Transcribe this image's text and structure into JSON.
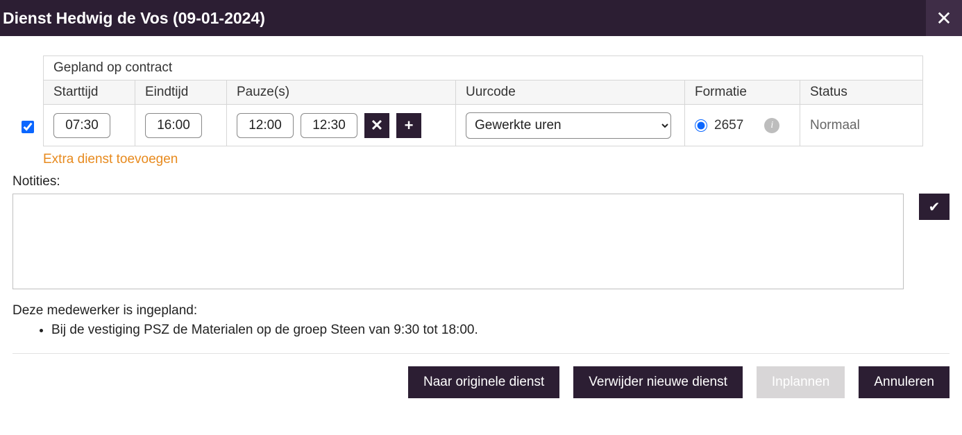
{
  "header": {
    "title": "Dienst Hedwig de Vos (09-01-2024)",
    "close_icon": "✕"
  },
  "table": {
    "superheader": "Gepland op contract",
    "headers": {
      "start": "Starttijd",
      "end": "Eindtijd",
      "pause": "Pauze(s)",
      "uurcode": "Uurcode",
      "formatie": "Formatie",
      "status": "Status"
    },
    "row": {
      "checked": true,
      "start": "07:30",
      "end": "16:00",
      "pause_start": "12:00",
      "pause_end": "12:30",
      "remove_icon": "✕",
      "add_icon": "+",
      "uurcode_value": "Gewerkte uren",
      "formatie_selected": true,
      "formatie_value": "2657",
      "info_icon": "i",
      "status": "Normaal"
    }
  },
  "extra_link": "Extra dienst toevoegen",
  "notes": {
    "label": "Notities:",
    "value": "",
    "confirm_icon": "✔"
  },
  "scheduled": {
    "intro": "Deze medewerker is ingepland:",
    "items": [
      "Bij de vestiging PSZ de Materialen op de groep Steen van 9:30 tot 18:00."
    ]
  },
  "footer": {
    "to_original": "Naar originele dienst",
    "delete_new": "Verwijder nieuwe dienst",
    "plan": "Inplannen",
    "cancel": "Annuleren"
  }
}
